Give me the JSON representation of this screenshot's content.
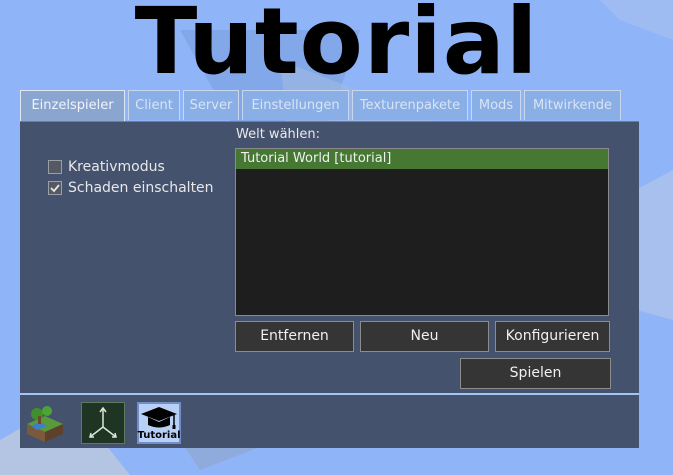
{
  "title": "Tutorial",
  "tabs": [
    {
      "label": "Einzelspieler"
    },
    {
      "label": "Client"
    },
    {
      "label": "Server"
    },
    {
      "label": "Einstellungen"
    },
    {
      "label": "Texturenpakete"
    },
    {
      "label": "Mods"
    },
    {
      "label": "Mitwirkende"
    }
  ],
  "active_tab": "Einzelspieler",
  "options": {
    "creative": {
      "label": "Kreativmodus",
      "checked": false
    },
    "damage": {
      "label": "Schaden einschalten",
      "checked": true
    }
  },
  "world": {
    "label": "Welt wählen:",
    "items": [
      "Tutorial World [tutorial]"
    ],
    "selected": "Tutorial World [tutorial]"
  },
  "buttons": {
    "delete": "Entfernen",
    "new": "Neu",
    "configure": "Konfigurieren",
    "play": "Spielen"
  },
  "gamebar": {
    "items": [
      {
        "icon": "minetest-game-icon"
      },
      {
        "icon": "axes-game-icon"
      },
      {
        "icon": "tutorial-graduation-cap-icon",
        "label": "Tutorial",
        "selected": true
      }
    ]
  },
  "colors": {
    "background": "#8fb4f8",
    "panel": "#44526e",
    "selection": "#467833"
  }
}
